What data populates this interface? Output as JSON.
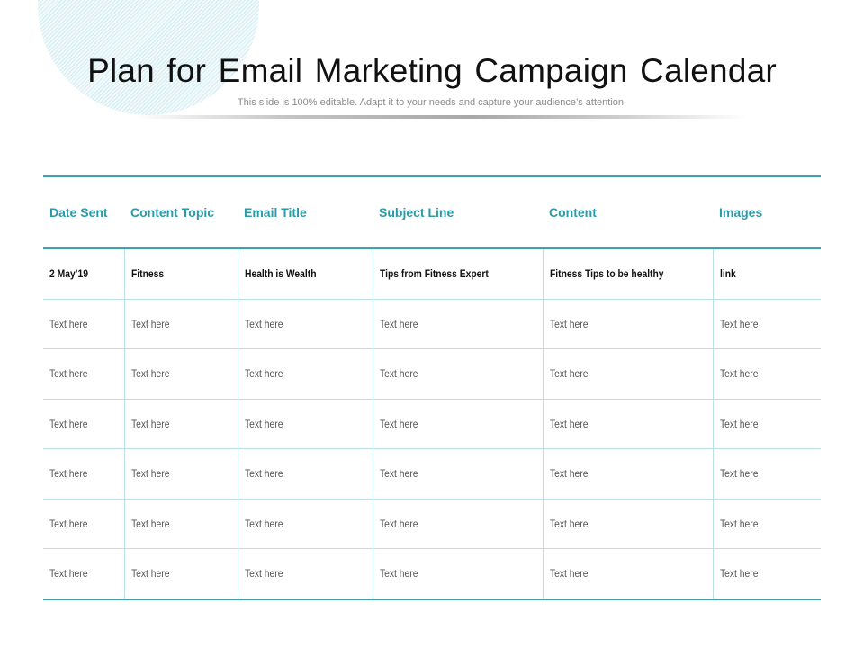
{
  "slide": {
    "title": "Plan for Email Marketing Campaign Calendar",
    "subtitle": "This slide is 100% editable. Adapt it to your needs and capture your audience’s attention."
  },
  "colors": {
    "accent": "#2a9aa6",
    "grid": "#b8e0e6"
  },
  "table": {
    "headers": [
      "Date Sent",
      "Content Topic",
      "Email Title",
      "Subject Line",
      "Content",
      "Images"
    ],
    "rows": [
      [
        "2 May’19",
        "Fitness",
        "Health is Wealth",
        "Tips from Fitness Expert",
        "Fitness Tips to be healthy",
        "link"
      ],
      [
        "Text here",
        "Text here",
        "Text here",
        "Text here",
        "Text here",
        "Text here"
      ],
      [
        "Text here",
        "Text here",
        "Text here",
        "Text here",
        "Text here",
        "Text here"
      ],
      [
        "Text here",
        "Text here",
        "Text here",
        "Text here",
        "Text here",
        "Text here"
      ],
      [
        "Text here",
        "Text here",
        "Text here",
        "Text here",
        "Text here",
        "Text here"
      ],
      [
        "Text here",
        "Text here",
        "Text here",
        "Text here",
        "Text here",
        "Text here"
      ],
      [
        "Text here",
        "Text here",
        "Text here",
        "Text here",
        "Text here",
        "Text here"
      ]
    ]
  }
}
